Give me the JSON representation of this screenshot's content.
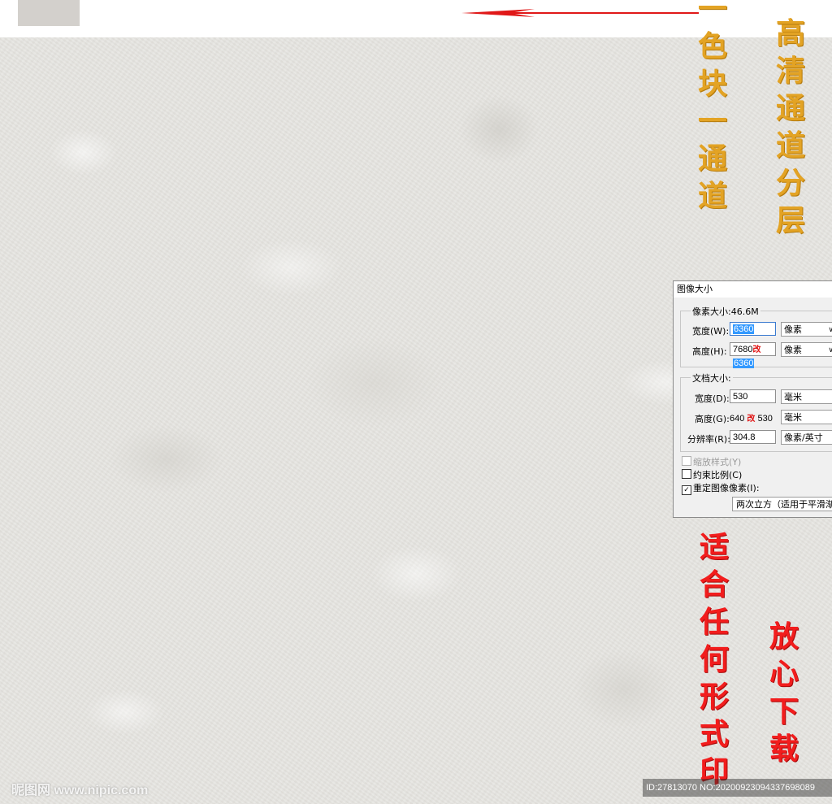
{
  "colors": {
    "gold_text": "#e3a324",
    "red_text": "#f21d1d",
    "swatch": "#d3d0cc",
    "arrow": "#e01818",
    "background_texture": "#e4e3df"
  },
  "annotations": {
    "gold_left": [
      "一",
      "色",
      "块",
      "一",
      "通",
      "道"
    ],
    "gold_right": [
      "高",
      "清",
      "通",
      "道",
      "分",
      "层"
    ],
    "red_left": [
      "适",
      "合",
      "任",
      "何",
      "形",
      "式",
      "印"
    ],
    "red_right": [
      "放",
      "心",
      "下",
      "载"
    ]
  },
  "dialog": {
    "title": "图像大小",
    "pixel_dimensions": {
      "label": "像素大小:46.6M",
      "width_label": "宽度(W):",
      "width_value": "6360",
      "width_unit": "像素",
      "height_label": "高度(H):",
      "height_old": "7680",
      "height_mark": "改",
      "height_value": "6360",
      "height_unit": "像素"
    },
    "document_size": {
      "label": "文档大小:",
      "width_label": "宽度(D):",
      "width_value": "530",
      "width_unit": "毫米",
      "height_label": "高度(G):",
      "height_old": "640",
      "height_mark": "改",
      "height_value": "530",
      "height_unit": "毫米",
      "resolution_label": "分辨率(R):",
      "resolution_value": "304.8",
      "resolution_unit": "像素/英寸"
    },
    "options": {
      "scale_styles": "缩放样式(Y)",
      "constrain": "约束比例(C)",
      "resample": "重定图像像素(I):",
      "resample_checked": true,
      "resample_method": "两次立方（适用于平滑渐变"
    }
  },
  "watermark": "昵图网 www.nipic.com",
  "footer_id": "ID:27813070 NO:20200923094337698089"
}
